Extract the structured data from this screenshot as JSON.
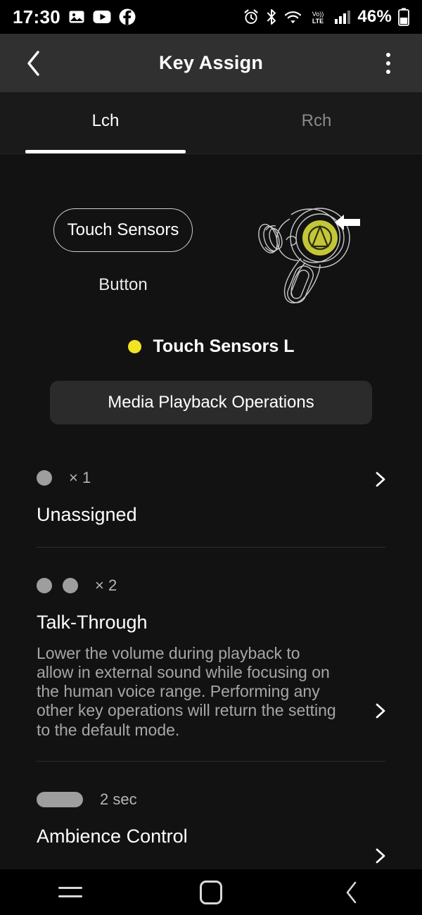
{
  "status_bar": {
    "time": "17:30",
    "left_icons": [
      "photos-icon",
      "youtube-icon",
      "facebook-icon"
    ],
    "right_icons": [
      "alarm-icon",
      "bluetooth-icon",
      "wifi-icon",
      "volte-icon",
      "signal-icon"
    ],
    "volte_label": "Vo))\nLTE",
    "battery_percent": "46%"
  },
  "app_bar": {
    "back_label": "back-icon",
    "title": "Key Assign",
    "menu_label": "overflow-menu-icon"
  },
  "tabs": [
    {
      "label": "Lch",
      "active": true
    },
    {
      "label": "Rch",
      "active": false
    }
  ],
  "selector": {
    "selected_option": "Touch Sensors",
    "other_option": "Button",
    "illustration": "earbud-left-illustration",
    "pointer": "arrow-left-icon",
    "highlight_color": "#c3c636"
  },
  "current_sensor": {
    "dot_color": "#f2e422",
    "label": "Touch Sensors L"
  },
  "mode_button": {
    "label": "Media Playback Operations"
  },
  "assignments": [
    {
      "gesture": "tap",
      "taps": 1,
      "count_label": "× 1",
      "title": "Unassigned",
      "description": ""
    },
    {
      "gesture": "tap",
      "taps": 2,
      "count_label": "× 2",
      "title": "Talk-Through",
      "description": "Lower the volume during playback to allow in external sound while focusing on the human voice range. Performing any other key operations will return the setting to the default mode."
    },
    {
      "gesture": "hold",
      "taps": 0,
      "count_label": "2 sec",
      "title": "Ambience Control",
      "description": ""
    }
  ],
  "nav_bar": {
    "recents_label": "recents-icon",
    "home_label": "home-icon",
    "back_label": "back-icon"
  }
}
